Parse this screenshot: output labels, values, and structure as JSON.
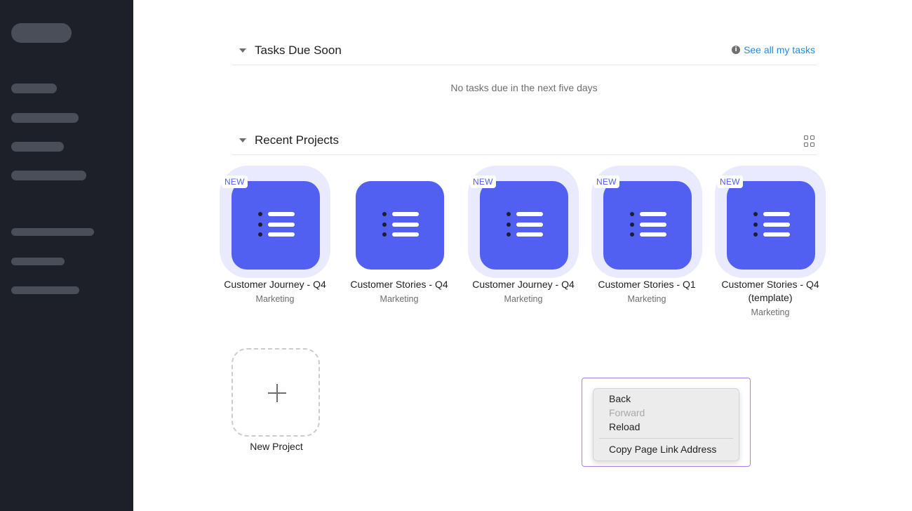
{
  "tasks_section": {
    "title": "Tasks Due Soon",
    "see_all": "See all my tasks",
    "empty_message": "No tasks due in the next five days"
  },
  "projects_section": {
    "title": "Recent Projects",
    "projects": [
      {
        "name": "Customer Journey - Q4",
        "team": "Marketing",
        "badge": "NEW"
      },
      {
        "name": "Customer Stories - Q4",
        "team": "Marketing",
        "badge": ""
      },
      {
        "name": "Customer Journey - Q4",
        "team": "Marketing",
        "badge": "NEW"
      },
      {
        "name": "Customer Stories - Q1",
        "team": "Marketing",
        "badge": "NEW"
      },
      {
        "name": "Customer Stories - Q4 (template)",
        "team": "Marketing",
        "badge": "NEW"
      }
    ],
    "new_project_label": "New Project"
  },
  "context_menu": {
    "items": [
      "Back",
      "Forward",
      "Reload",
      "Copy Page Link Address"
    ],
    "disabled": [
      "Forward"
    ]
  },
  "colors": {
    "sidebar": "#1e2029",
    "tile": "#5160f0",
    "link": "#1f8ce6",
    "highlight_frame": "#a87ef5"
  }
}
